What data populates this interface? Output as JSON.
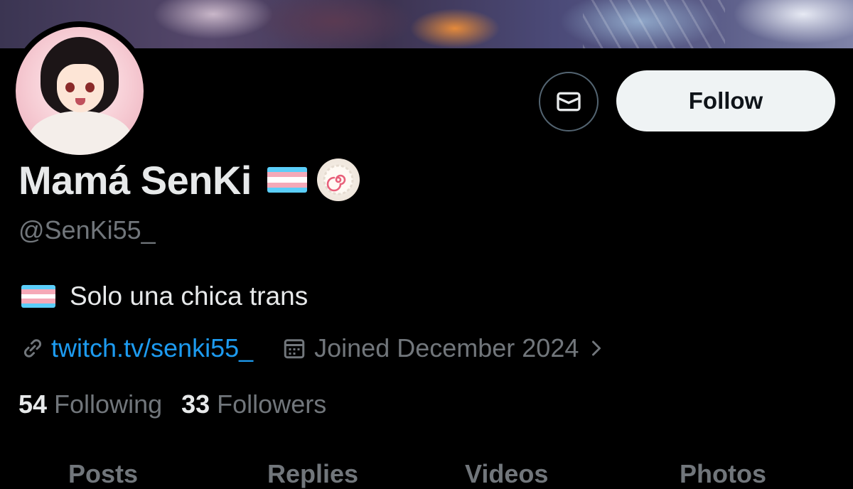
{
  "profile": {
    "display_name": "Mamá SenKi",
    "handle": "@SenKi55_",
    "bio": "Solo una chica trans",
    "link": "twitch.tv/senki55_",
    "joined": "Joined December 2024",
    "avatar_icon": "avatar-anime-girl"
  },
  "actions": {
    "message_icon": "mail-icon",
    "follow_label": "Follow"
  },
  "stats": {
    "following_count": "54",
    "following_label": "Following",
    "followers_count": "33",
    "followers_label": "Followers"
  },
  "tabs": [
    {
      "label": "Posts"
    },
    {
      "label": "Replies"
    },
    {
      "label": "Videos"
    },
    {
      "label": "Photos"
    }
  ],
  "colors": {
    "background": "#000000",
    "text_primary": "#e7e9ea",
    "text_secondary": "#71767b",
    "link": "#1d9bf0",
    "follow_button_bg": "#eff3f4",
    "trans_flag": [
      "#5bcefa",
      "#f5a9b8",
      "#ffffff",
      "#f5a9b8",
      "#5bcefa"
    ]
  }
}
